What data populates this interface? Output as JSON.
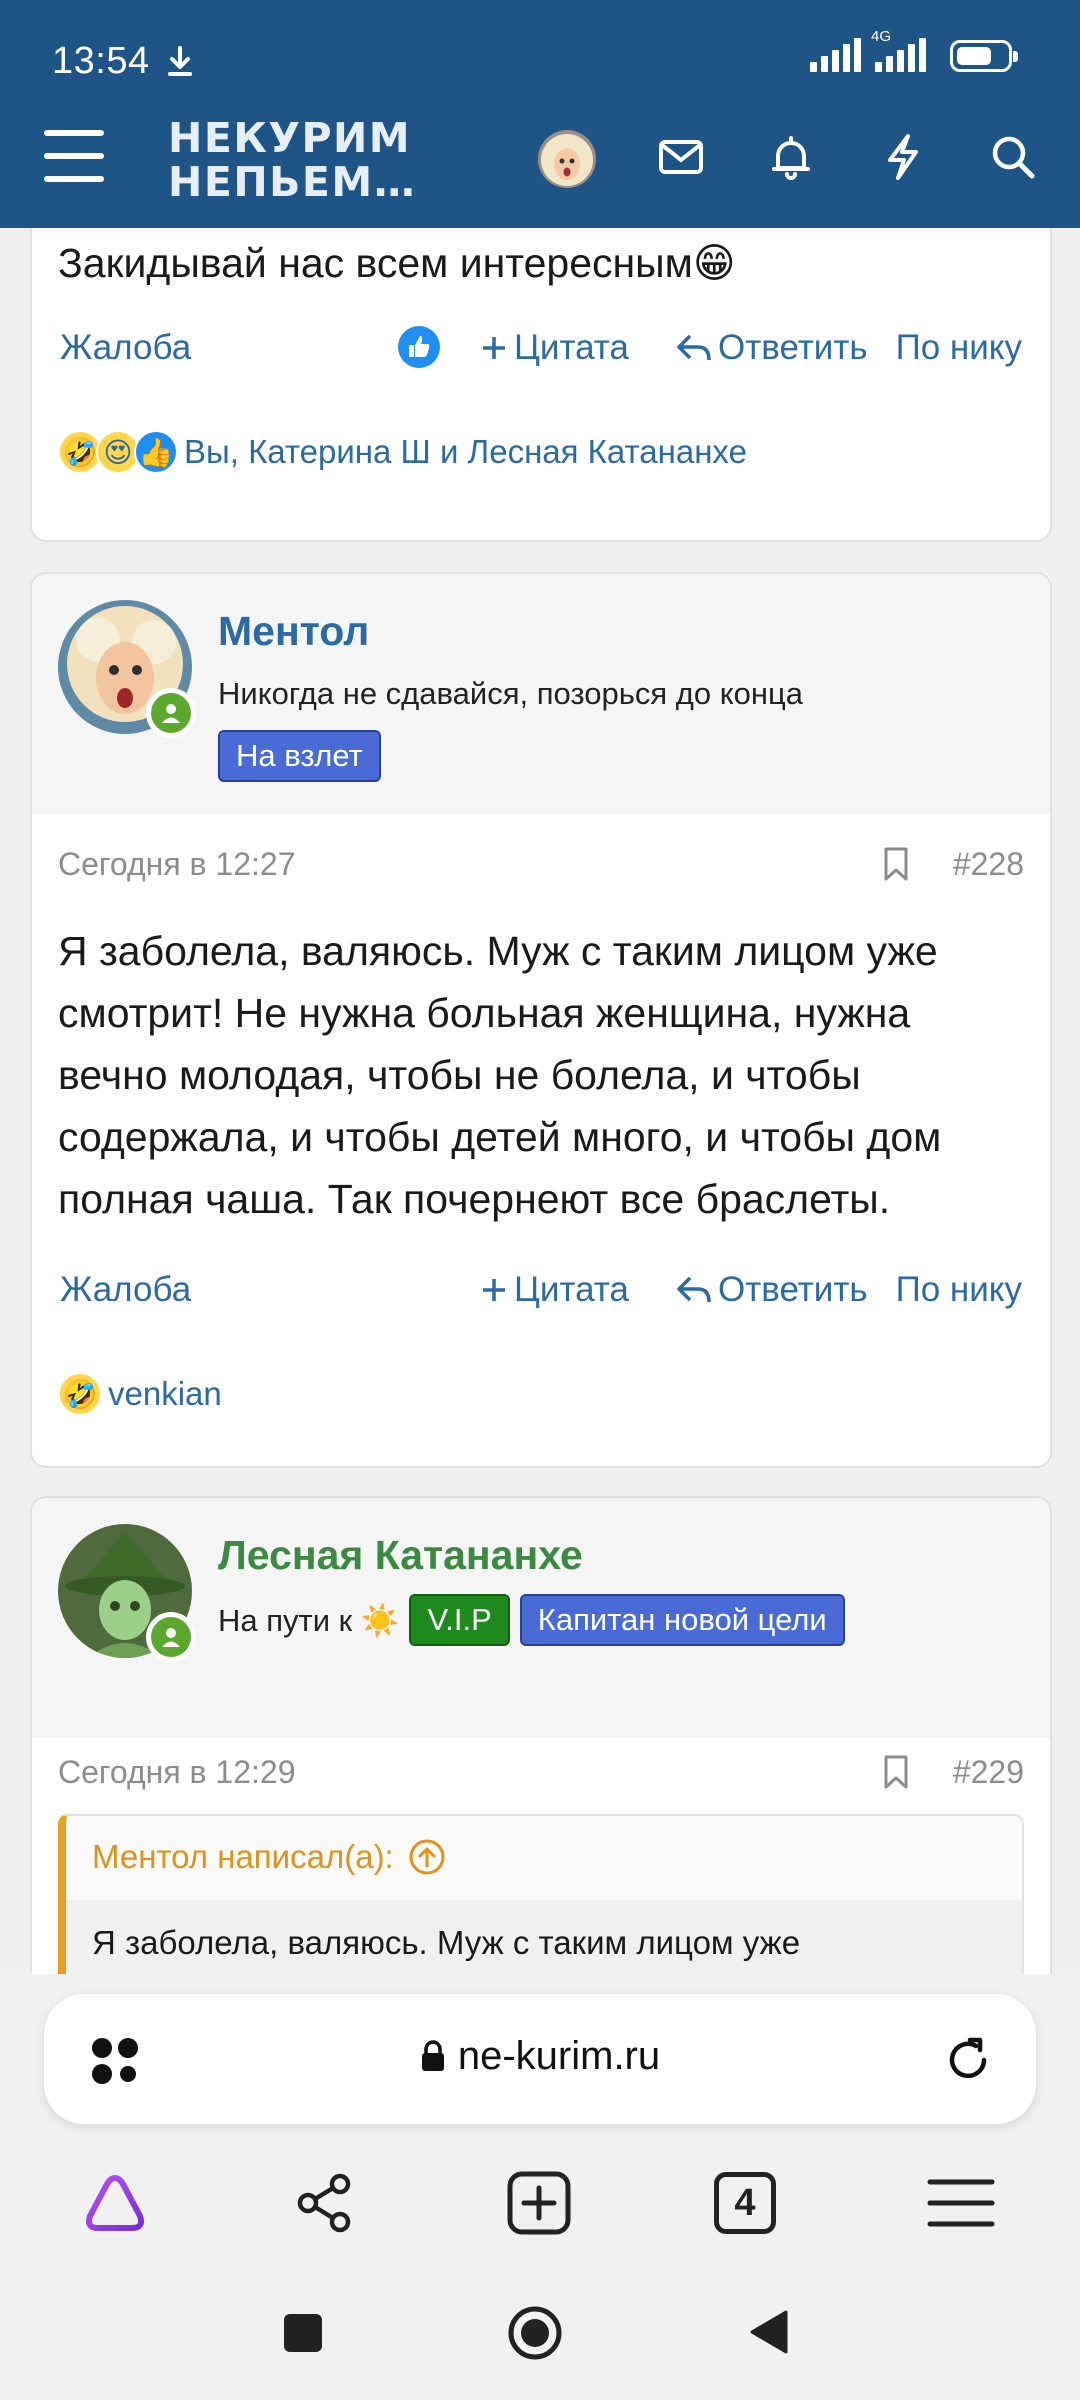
{
  "status_bar": {
    "time": "13:54",
    "network": "4G"
  },
  "header": {
    "logo_line1": "НЕКУРИМ",
    "logo_line2": "НЕПЬЕМ…",
    "icons": [
      "menu-icon",
      "avatar",
      "mail-icon",
      "bell-icon",
      "lightning-icon",
      "search-icon"
    ]
  },
  "posts": [
    {
      "text": "Закидывай нас всем интересным😁",
      "actions": {
        "report": "Жалоба",
        "quote": "Цитата",
        "reply": "Ответить",
        "by_nick": "По нику"
      },
      "reactions_text": "Вы, Катерина Ш и Лесная Катананхе",
      "reaction_emojis": [
        "🤣",
        "😍",
        "👍"
      ]
    },
    {
      "author": "Ментол",
      "author_color": "#2a6aa5",
      "user_title": "Никогда не сдавайся, позорься до конца",
      "badges": [
        {
          "label": "На взлет",
          "color": "#4a6bd6"
        }
      ],
      "date": "Сегодня в 12:27",
      "number": "#228",
      "text": "Я заболела, валяюсь. Муж с таким лицом уже смотрит! Не нужна больная женщина, нужна вечно молодая, чтобы не болела, и чтобы содержала, и чтобы детей много, и чтобы дом полная чаша. Так почернеют все браслеты.",
      "actions": {
        "report": "Жалоба",
        "quote": "Цитата",
        "reply": "Ответить",
        "by_nick": "По нику"
      },
      "reactions_text": "venkian",
      "reaction_emojis": [
        "🤣"
      ]
    },
    {
      "author": "Лесная Катананхе",
      "author_color": "#3c8a42",
      "user_title": "На пути к ☀️",
      "badges": [
        {
          "label": "V.I.P",
          "color": "#1e8a1e"
        },
        {
          "label": "Капитан новой цели",
          "color": "#4a6bd6"
        }
      ],
      "date": "Сегодня в 12:29",
      "number": "#229",
      "quote_header": "Ментол написал(а):",
      "quote_text": "Я заболела, валяюсь. Муж с таким лицом уже"
    }
  ],
  "browser": {
    "url": "ne-kurim.ru",
    "tabs_count": "4",
    "icons": [
      "apps-icon",
      "lock-icon",
      "reload-icon",
      "alice-icon",
      "share-icon",
      "new-tab-icon",
      "tabs-icon",
      "browser-menu-icon"
    ]
  },
  "system_nav": [
    "recents-icon",
    "home-icon",
    "back-icon"
  ]
}
